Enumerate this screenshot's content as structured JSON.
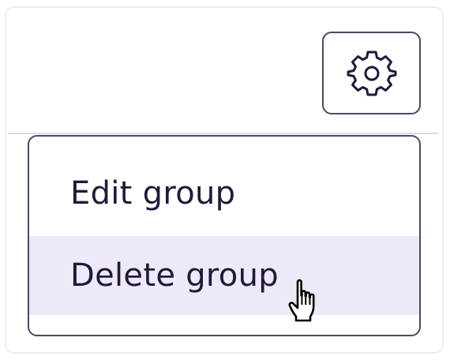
{
  "settings_button": {
    "icon": "gear-icon"
  },
  "menu": {
    "items": [
      {
        "label": "Edit group",
        "state": "default"
      },
      {
        "label": "Delete group",
        "state": "hovered"
      }
    ]
  },
  "cursor": {
    "icon": "hand-pointer-cursor-icon"
  },
  "colors": {
    "border_dark": "#4a4864",
    "text": "#1d1b3a",
    "hover_background": "#efe8f9",
    "card_border": "#ececf1",
    "divider": "#dcdbe3"
  }
}
